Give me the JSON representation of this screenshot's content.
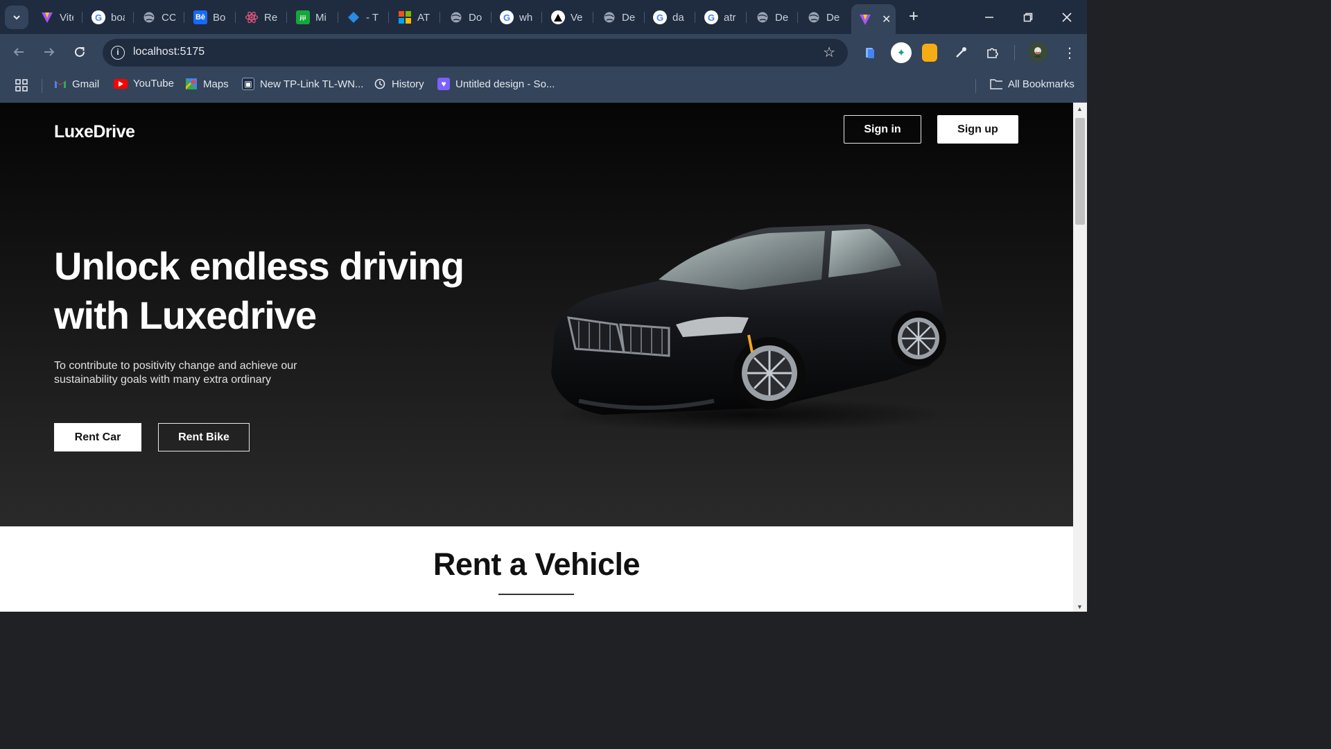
{
  "browser": {
    "tabs": [
      {
        "title": "Vite",
        "favicon": "vite-icon",
        "color": "#8b5cf6"
      },
      {
        "title": "boat",
        "favicon": "google-icon",
        "color": "#ffffff"
      },
      {
        "title": "CC",
        "favicon": "globe-icon",
        "color": "#9aa4b4"
      },
      {
        "title": "Bo",
        "favicon": "behance-icon",
        "color": "#1769ff"
      },
      {
        "title": "Re",
        "favicon": "react-icon",
        "color": "#e0567a"
      },
      {
        "title": "Mi",
        "favicon": "jiji-icon",
        "color": "#14a83c"
      },
      {
        "title": "- T",
        "favicon": "grid-diamond-icon",
        "color": "#2b8ae2"
      },
      {
        "title": "AT",
        "favicon": "microsoft-icon",
        "color": "#f25022"
      },
      {
        "title": "Do",
        "favicon": "globe-icon",
        "color": "#9aa4b4"
      },
      {
        "title": "wh",
        "favicon": "google-icon",
        "color": "#ffffff"
      },
      {
        "title": "Ve",
        "favicon": "vercel-icon",
        "color": "#000000"
      },
      {
        "title": "De",
        "favicon": "globe-icon",
        "color": "#9aa4b4"
      },
      {
        "title": "da",
        "favicon": "google-icon",
        "color": "#ffffff"
      },
      {
        "title": "atr",
        "favicon": "google-icon",
        "color": "#ffffff"
      },
      {
        "title": "De",
        "favicon": "globe-icon",
        "color": "#9aa4b4"
      },
      {
        "title": "De",
        "favicon": "globe-icon",
        "color": "#9aa4b4"
      }
    ],
    "active_tab": {
      "favicon": "vite-icon"
    },
    "url": "localhost:5175",
    "bookmarks": [
      {
        "label": "Gmail",
        "icon": "gmail-icon"
      },
      {
        "label": "YouTube",
        "icon": "youtube-icon"
      },
      {
        "label": "Maps",
        "icon": "maps-icon"
      },
      {
        "label": "New TP-Link TL-WN...",
        "icon": "tplink-icon"
      },
      {
        "label": "History",
        "icon": "history-icon"
      },
      {
        "label": "Untitled design - So...",
        "icon": "canva-heart-icon"
      }
    ],
    "all_bookmarks_label": "All Bookmarks"
  },
  "page": {
    "logo": "LuxeDrive",
    "nav": {
      "signin": "Sign in",
      "signup": "Sign up"
    },
    "hero": {
      "headline": "Unlock endless driving with Luxedrive",
      "subtext": "To contribute to positivity change and achieve our sustainability goals with many extra ordinary",
      "rent_car": "Rent Car",
      "rent_bike": "Rent Bike",
      "image": "black-sedan-car-image"
    },
    "section_title": "Rent a Vehicle"
  },
  "colors": {
    "tabstrip": "#1f2c3f",
    "toolbar": "#34445b",
    "hero_top": "#050505",
    "hero_bottom": "#2a2a2a"
  }
}
